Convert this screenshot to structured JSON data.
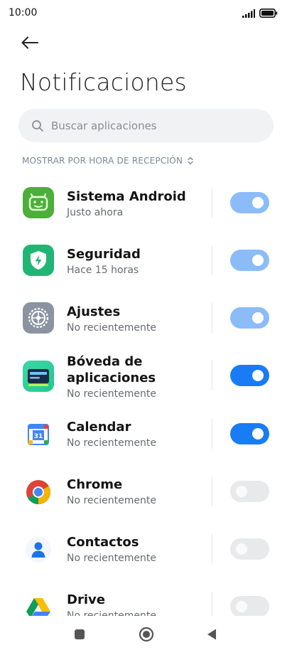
{
  "status_bar": {
    "time": "10:00",
    "icons": [
      "signal-icon",
      "battery-icon"
    ]
  },
  "header": {
    "back_icon": "arrow-left-icon",
    "title": "Notificaciones"
  },
  "search": {
    "placeholder": "Buscar aplicaciones",
    "value": "",
    "icon": "search-icon"
  },
  "sort": {
    "label": "MOSTRAR POR HORA DE RECEPCIÓN",
    "icon": "sort-updown-icon"
  },
  "apps": [
    {
      "name": "Sistema Android",
      "subtitle": "Justo ahora",
      "icon": "android-system-icon",
      "toggle": "on-disabled",
      "color": "#4caf3a"
    },
    {
      "name": "Seguridad",
      "subtitle": "Hace 15 horas",
      "icon": "security-shield-icon",
      "toggle": "on-disabled",
      "color": "#21b573"
    },
    {
      "name": "Ajustes",
      "subtitle": "No recientemente",
      "icon": "settings-gear-icon",
      "toggle": "on-disabled",
      "color": "#8a939f"
    },
    {
      "name": "Bóveda de aplicaciones",
      "subtitle": "No recientemente",
      "icon": "app-vault-icon",
      "toggle": "on",
      "color": "#1fc98e"
    },
    {
      "name": "Calendar",
      "subtitle": "No recientemente",
      "icon": "google-calendar-icon",
      "toggle": "on",
      "color": "#4285f4"
    },
    {
      "name": "Chrome",
      "subtitle": "No recientemente",
      "icon": "chrome-icon",
      "toggle": "off",
      "color": "#db4437"
    },
    {
      "name": "Contactos",
      "subtitle": "No recientemente",
      "icon": "contacts-icon",
      "toggle": "off",
      "color": "#1a73e8"
    },
    {
      "name": "Drive",
      "subtitle": "No recientemente",
      "icon": "google-drive-icon",
      "toggle": "off",
      "color": "#0f9d58"
    }
  ],
  "nav_bar": {
    "icons": [
      "recents-square-icon",
      "home-circle-icon",
      "back-triangle-icon"
    ]
  },
  "colors": {
    "toggle_on": "#1a7cf5",
    "toggle_on_disabled": "#8bbcf9",
    "toggle_off": "#e8e9eb",
    "sort_label": "#7f8594"
  }
}
